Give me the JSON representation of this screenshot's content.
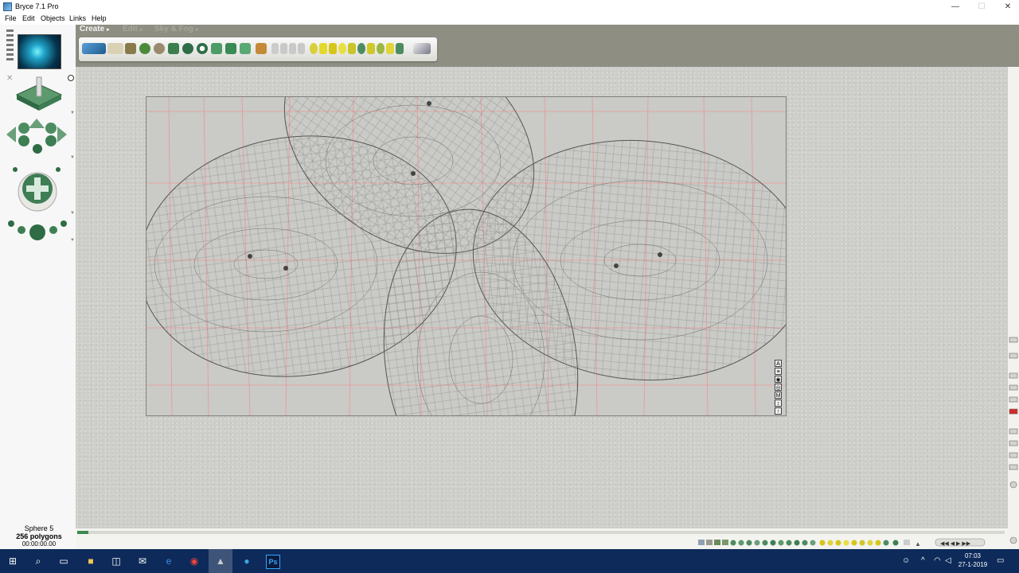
{
  "window": {
    "title": "Bryce 7.1  Pro",
    "min": "—",
    "max": "☐",
    "close": "✕"
  },
  "menu": [
    "File",
    "Edit",
    "Objects",
    "Links",
    "Help"
  ],
  "tabs": {
    "create": "Create",
    "edit": "Edit",
    "sky": "Sky & Fog",
    "arrow": "▸"
  },
  "view_controls": [
    "A",
    "≡",
    "◉",
    "◎",
    "M",
    "↕",
    "↑"
  ],
  "status": {
    "object": "Sphere 5",
    "polygons": "256 polygons",
    "time": "00:00:00.00"
  },
  "clock": {
    "time": "07:03",
    "date": "27-1-2019"
  },
  "taskbar_icons": [
    "start-icon",
    "search-icon",
    "task-view-icon",
    "file-explorer-icon",
    "store-icon",
    "mail-icon",
    "edge-icon",
    "chrome-icon",
    "bryce-icon",
    "telegram-icon",
    "photoshop-icon"
  ],
  "colors": {
    "workspace": "#cdcdca",
    "frame": "#8e8e83",
    "grid_red": "#e89898",
    "wire": "#555555",
    "taskbar": "#0d2a5a"
  }
}
